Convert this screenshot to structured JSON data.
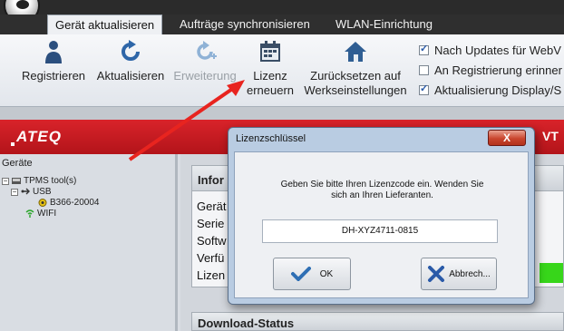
{
  "ribbon_tabs": [
    {
      "label": "Gerät aktualisieren",
      "active": true
    },
    {
      "label": "Aufträge synchronisieren",
      "active": false
    },
    {
      "label": "WLAN-Einrichtung",
      "active": false
    }
  ],
  "ribbon_buttons": {
    "registrieren": {
      "label": "Registrieren",
      "icon": "person-icon"
    },
    "aktualisieren": {
      "label": "Aktualisieren",
      "icon": "refresh-icon"
    },
    "erweiterung": {
      "label": "Erweiterung",
      "icon": "refresh-plus-icon",
      "disabled": true
    },
    "lizenz": {
      "label_line1": "Lizenz",
      "label_line2": "erneuern",
      "icon": "calendar-icon"
    },
    "zuruecksetzen": {
      "label_line1": "Zurücksetzen auf",
      "label_line2": "Werkseinstellungen",
      "icon": "house-icon"
    }
  },
  "ribbon_checks": [
    {
      "label": "Nach Updates für WebV",
      "checked": true
    },
    {
      "label": "An Registrierung erinner",
      "checked": false
    },
    {
      "label": "Aktualisierung Display/S",
      "checked": true
    }
  ],
  "header": {
    "logo": "ATEQ",
    "right_text": "VT"
  },
  "tree": {
    "title": "Geräte",
    "nodes": [
      "TPMS tool(s)",
      "USB",
      "B366-20004",
      "WIFI"
    ]
  },
  "info": {
    "head": "Infor",
    "rows": [
      "Gerät",
      "Serie",
      "Softw",
      "Verfü",
      "Lizen"
    ]
  },
  "download_head": "Download-Status",
  "dialog": {
    "title": "Lizenzschlüssel",
    "close": "X",
    "message_line1": "Geben Sie bitte Ihren Lizenzcode ein. Wenden Sie",
    "message_line2": "sich an Ihren Lieferanten.",
    "license_value": "DH-XYZ4711-0815",
    "ok_label": "OK",
    "cancel_label": "Abbrech..."
  },
  "colors": {
    "brand_red": "#c81c22",
    "ok_check": "#2f6fb4",
    "cancel_x": "#2a5aa8",
    "progress_green": "#37d61a",
    "annotation_arrow": "#e8241f"
  }
}
